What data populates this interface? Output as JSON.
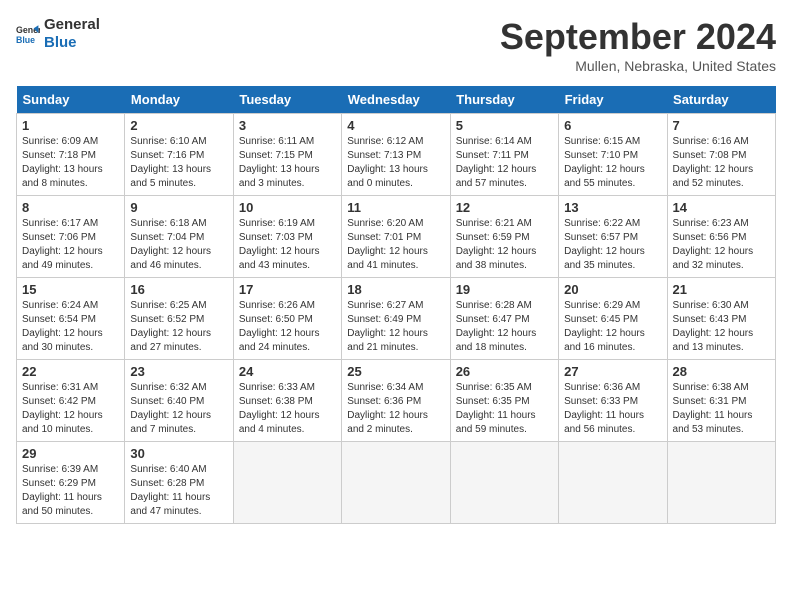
{
  "logo": {
    "line1": "General",
    "line2": "Blue"
  },
  "title": "September 2024",
  "location": "Mullen, Nebraska, United States",
  "days_of_week": [
    "Sunday",
    "Monday",
    "Tuesday",
    "Wednesday",
    "Thursday",
    "Friday",
    "Saturday"
  ],
  "weeks": [
    [
      {
        "day": "1",
        "sunrise": "6:09 AM",
        "sunset": "7:18 PM",
        "daylight": "13 hours and 8 minutes."
      },
      {
        "day": "2",
        "sunrise": "6:10 AM",
        "sunset": "7:16 PM",
        "daylight": "13 hours and 5 minutes."
      },
      {
        "day": "3",
        "sunrise": "6:11 AM",
        "sunset": "7:15 PM",
        "daylight": "13 hours and 3 minutes."
      },
      {
        "day": "4",
        "sunrise": "6:12 AM",
        "sunset": "7:13 PM",
        "daylight": "13 hours and 0 minutes."
      },
      {
        "day": "5",
        "sunrise": "6:14 AM",
        "sunset": "7:11 PM",
        "daylight": "12 hours and 57 minutes."
      },
      {
        "day": "6",
        "sunrise": "6:15 AM",
        "sunset": "7:10 PM",
        "daylight": "12 hours and 55 minutes."
      },
      {
        "day": "7",
        "sunrise": "6:16 AM",
        "sunset": "7:08 PM",
        "daylight": "12 hours and 52 minutes."
      }
    ],
    [
      {
        "day": "8",
        "sunrise": "6:17 AM",
        "sunset": "7:06 PM",
        "daylight": "12 hours and 49 minutes."
      },
      {
        "day": "9",
        "sunrise": "6:18 AM",
        "sunset": "7:04 PM",
        "daylight": "12 hours and 46 minutes."
      },
      {
        "day": "10",
        "sunrise": "6:19 AM",
        "sunset": "7:03 PM",
        "daylight": "12 hours and 43 minutes."
      },
      {
        "day": "11",
        "sunrise": "6:20 AM",
        "sunset": "7:01 PM",
        "daylight": "12 hours and 41 minutes."
      },
      {
        "day": "12",
        "sunrise": "6:21 AM",
        "sunset": "6:59 PM",
        "daylight": "12 hours and 38 minutes."
      },
      {
        "day": "13",
        "sunrise": "6:22 AM",
        "sunset": "6:57 PM",
        "daylight": "12 hours and 35 minutes."
      },
      {
        "day": "14",
        "sunrise": "6:23 AM",
        "sunset": "6:56 PM",
        "daylight": "12 hours and 32 minutes."
      }
    ],
    [
      {
        "day": "15",
        "sunrise": "6:24 AM",
        "sunset": "6:54 PM",
        "daylight": "12 hours and 30 minutes."
      },
      {
        "day": "16",
        "sunrise": "6:25 AM",
        "sunset": "6:52 PM",
        "daylight": "12 hours and 27 minutes."
      },
      {
        "day": "17",
        "sunrise": "6:26 AM",
        "sunset": "6:50 PM",
        "daylight": "12 hours and 24 minutes."
      },
      {
        "day": "18",
        "sunrise": "6:27 AM",
        "sunset": "6:49 PM",
        "daylight": "12 hours and 21 minutes."
      },
      {
        "day": "19",
        "sunrise": "6:28 AM",
        "sunset": "6:47 PM",
        "daylight": "12 hours and 18 minutes."
      },
      {
        "day": "20",
        "sunrise": "6:29 AM",
        "sunset": "6:45 PM",
        "daylight": "12 hours and 16 minutes."
      },
      {
        "day": "21",
        "sunrise": "6:30 AM",
        "sunset": "6:43 PM",
        "daylight": "12 hours and 13 minutes."
      }
    ],
    [
      {
        "day": "22",
        "sunrise": "6:31 AM",
        "sunset": "6:42 PM",
        "daylight": "12 hours and 10 minutes."
      },
      {
        "day": "23",
        "sunrise": "6:32 AM",
        "sunset": "6:40 PM",
        "daylight": "12 hours and 7 minutes."
      },
      {
        "day": "24",
        "sunrise": "6:33 AM",
        "sunset": "6:38 PM",
        "daylight": "12 hours and 4 minutes."
      },
      {
        "day": "25",
        "sunrise": "6:34 AM",
        "sunset": "6:36 PM",
        "daylight": "12 hours and 2 minutes."
      },
      {
        "day": "26",
        "sunrise": "6:35 AM",
        "sunset": "6:35 PM",
        "daylight": "11 hours and 59 minutes."
      },
      {
        "day": "27",
        "sunrise": "6:36 AM",
        "sunset": "6:33 PM",
        "daylight": "11 hours and 56 minutes."
      },
      {
        "day": "28",
        "sunrise": "6:38 AM",
        "sunset": "6:31 PM",
        "daylight": "11 hours and 53 minutes."
      }
    ],
    [
      {
        "day": "29",
        "sunrise": "6:39 AM",
        "sunset": "6:29 PM",
        "daylight": "11 hours and 50 minutes."
      },
      {
        "day": "30",
        "sunrise": "6:40 AM",
        "sunset": "6:28 PM",
        "daylight": "11 hours and 47 minutes."
      },
      null,
      null,
      null,
      null,
      null
    ]
  ]
}
